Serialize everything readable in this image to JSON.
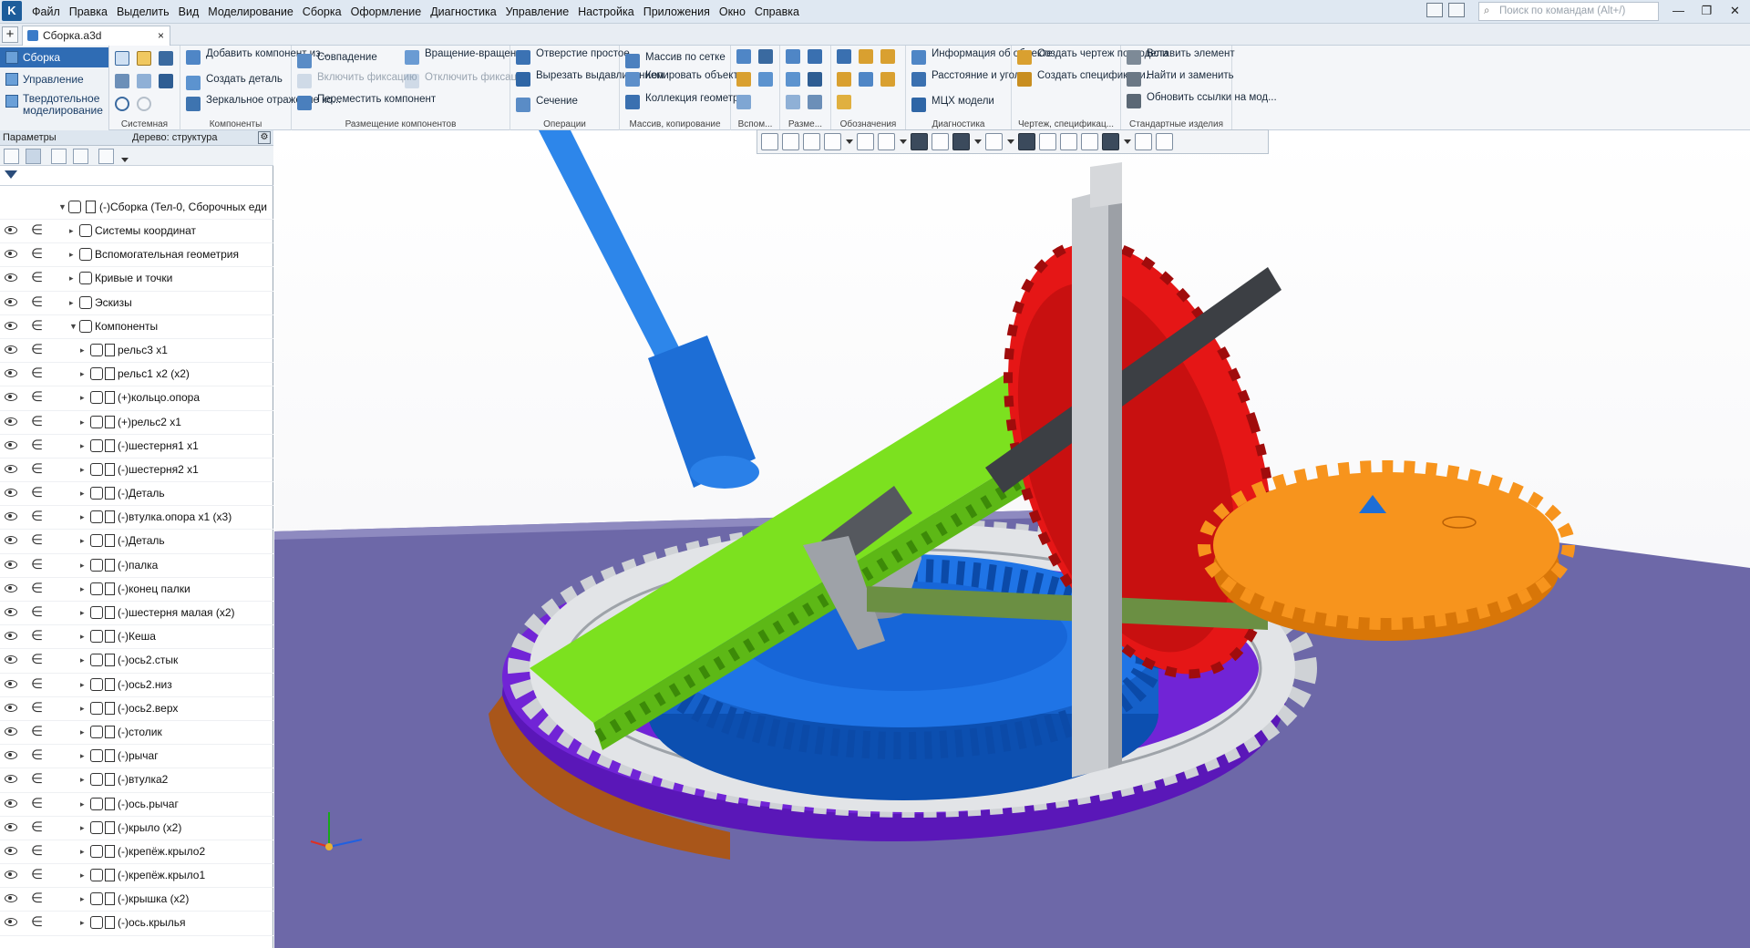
{
  "titlebar": {
    "menu": [
      "Файл",
      "Правка",
      "Выделить",
      "Вид",
      "Моделирование",
      "Сборка",
      "Оформление",
      "Диагностика",
      "Управление",
      "Настройка",
      "Приложения",
      "Окно",
      "Справка"
    ],
    "search_placeholder": "Поиск по командам (Alt+/)"
  },
  "tab": {
    "title": "Сборка.a3d",
    "close": "×",
    "add": "+"
  },
  "modes": [
    "Сборка",
    "Управление",
    "Твердотельное моделирование"
  ],
  "ribbon": {
    "groups": [
      "Системная",
      "Компоненты",
      "Размещение компонентов",
      "Операции",
      "Массив, копирование",
      "Вспом...",
      "Разме...",
      "Обозначения",
      "Диагностика",
      "Чертеж, спецификац...",
      "Стандартные изделия"
    ],
    "components": [
      "Добавить компонент из...",
      "Создать деталь",
      "Зеркальное отражение ко..."
    ],
    "placement": [
      "Совпадение",
      "Включить фиксацию",
      "Переместить компонент",
      "Вращение-вращение",
      "Отключить фиксацию"
    ],
    "operations": [
      "Отверстие простое",
      "Вырезать выдавливанием",
      "Сечение"
    ],
    "array": [
      "Массив по сетке",
      "Копировать объекты",
      "Коллекция геометрии"
    ],
    "diagnostics": [
      "Информация об объекте",
      "Расстояние и угол",
      "МЦХ модели"
    ],
    "drawing": [
      "Создать чертеж по модели",
      "Создать спецификаци..."
    ],
    "standard": [
      "Вставить элемент",
      "Найти и заменить",
      "Обновить ссылки на мод..."
    ]
  },
  "left_panel": {
    "title": "Параметры",
    "tree_title": "Дерево: структура",
    "root": "(-)Сборка (Тел-0, Сборочных еди",
    "items": [
      "Системы координат",
      "Вспомогательная геометрия",
      "Кривые и точки",
      "Эскизы",
      "Компоненты",
      "рельс3 x1",
      "рельс1 x2 (x2)",
      "(+)кольцо.опора",
      "(+)рельс2 x1",
      "(-)шестерня1  x1",
      "(-)шестерня2  x1",
      "(-)Деталь",
      "(-)втулка.опора x1 (x3)",
      "(-)Деталь",
      "(-)палка",
      "(-)конец палки",
      "(-)шестерня малая (x2)",
      "(-)Кеша",
      "(-)ось2.стык",
      "(-)ось2.низ",
      "(-)ось2.верх",
      "(-)столик",
      "(-)рычаг",
      "(-)втулка2",
      "(-)ось.рычаг",
      "(-)крыло (x2)",
      "(-)крепёж.крыло2",
      "(-)крепёж.крыло1",
      "(-)крышка (x2)",
      "(-)ось.крылья"
    ]
  },
  "colors": {
    "accent": "#2f6cb4",
    "base_plate": "#6b67a8",
    "green_gear": "#7ee02a",
    "red_gear": "#e81a1a",
    "blue_gear": "#1a6ee0",
    "orange_gear": "#f7941d",
    "ring_gray": "#d9dcdf"
  }
}
